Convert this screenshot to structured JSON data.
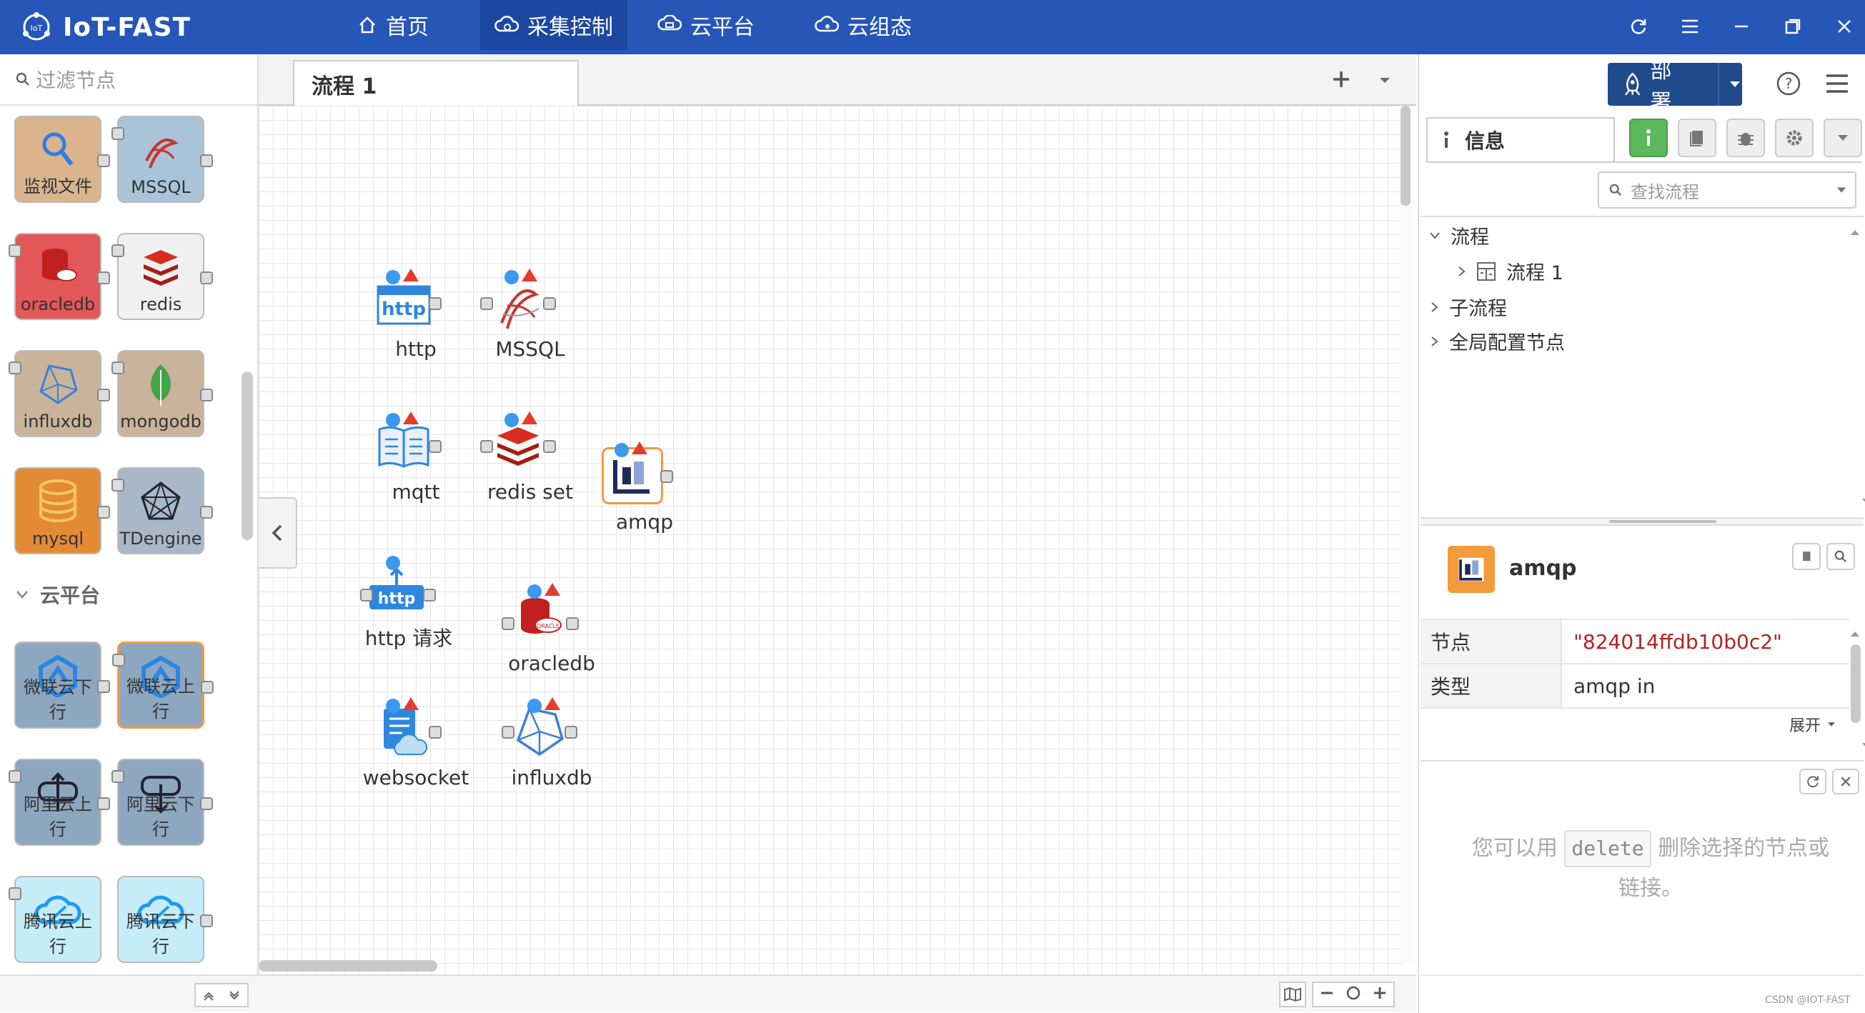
{
  "header": {
    "app_title": "IoT-FAST",
    "nav": [
      {
        "label": "首页",
        "icon": "home-icon"
      },
      {
        "label": "采集控制",
        "icon": "cloud-gear-icon",
        "active": true
      },
      {
        "label": "云平台",
        "icon": "cloud-monitor-icon"
      },
      {
        "label": "云组态",
        "icon": "cloud-settings-icon"
      }
    ],
    "window_icons": [
      "refresh-icon",
      "menu-icon",
      "minimize-icon",
      "maximize-icon",
      "close-icon"
    ]
  },
  "palette": {
    "filter_placeholder": "过滤节点",
    "nodes": [
      {
        "label": "监视文件",
        "color": "#d9b48c"
      },
      {
        "label": "MSSQL",
        "color": "#a9c4d8"
      },
      {
        "label": "oracledb",
        "color": "#e25757"
      },
      {
        "label": "redis",
        "color": "#f0f0f0"
      },
      {
        "label": "influxdb",
        "color": "#c9b39a"
      },
      {
        "label": "mongodb",
        "color": "#c9b39a"
      },
      {
        "label": "mysql",
        "color": "#e38b34"
      },
      {
        "label": "TDengine",
        "color": "#a9b8c8"
      }
    ],
    "category": "云平台",
    "cloud_nodes": [
      {
        "label": "微联云下行",
        "color": "#8ea7c0"
      },
      {
        "label": "微联云上行",
        "color": "#8ea7c0"
      },
      {
        "label": "阿里云上行",
        "color": "#8ea7c0"
      },
      {
        "label": "阿里云下行",
        "color": "#8ea7c0"
      },
      {
        "label": "腾讯云上行",
        "color": "#c5ecf7"
      },
      {
        "label": "腾讯云下行",
        "color": "#c5ecf7"
      }
    ]
  },
  "workspace": {
    "tab": "流程 1",
    "flow_nodes": [
      {
        "label": "http"
      },
      {
        "label": "MSSQL"
      },
      {
        "label": "mqtt"
      },
      {
        "label": "redis set"
      },
      {
        "label": "amqp"
      },
      {
        "label": "http 请求"
      },
      {
        "label": "oracledb"
      },
      {
        "label": "websocket"
      },
      {
        "label": "influxdb"
      }
    ]
  },
  "sidebar": {
    "deploy_label": "部署",
    "info_tab": "信息",
    "search_placeholder": "查找流程",
    "tree": {
      "flows": "流程",
      "flow1": "流程 1",
      "subflows": "子流程",
      "global_config": "全局配置节点"
    },
    "selected_node": {
      "name": "amqp",
      "rows": [
        {
          "key": "节点",
          "value": "\"824014ffdb10b0c2\""
        },
        {
          "key": "类型",
          "value": "amqp in"
        }
      ],
      "expand": "展开"
    },
    "tip_prefix": "您可以用",
    "tip_key": "delete",
    "tip_suffix": "删除选择的节点或",
    "tip_line2": "链接。",
    "watermark": "CSDN @IOT-FAST"
  },
  "colors": {
    "header": "#2556b8",
    "accent": "#1f4a8c",
    "info_green": "#5cb85c",
    "amqp_orange": "#f29a3c"
  }
}
